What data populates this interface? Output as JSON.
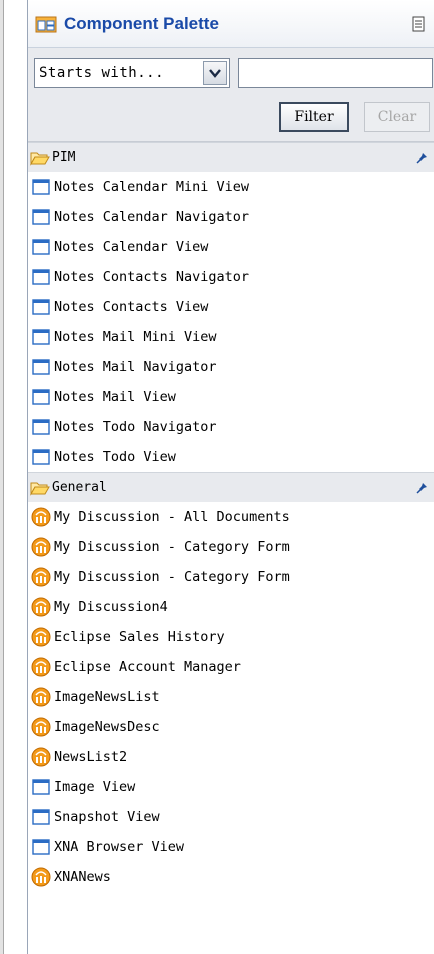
{
  "panel": {
    "title": "Component Palette",
    "title_icon": "palette-icon",
    "menu_icon": "view-menu-icon"
  },
  "filter": {
    "select_value": "Starts with...",
    "input_value": "",
    "filter_label": "Filter",
    "clear_label": "Clear"
  },
  "categories": [
    {
      "label": "PIM",
      "items": [
        {
          "label": "Notes Calendar Mini View",
          "icon": "view-window-icon"
        },
        {
          "label": "Notes Calendar Navigator",
          "icon": "view-window-icon"
        },
        {
          "label": "Notes Calendar View",
          "icon": "view-window-icon"
        },
        {
          "label": "Notes Contacts Navigator",
          "icon": "view-window-icon"
        },
        {
          "label": "Notes Contacts View",
          "icon": "view-window-icon"
        },
        {
          "label": "Notes Mail Mini View",
          "icon": "view-window-icon"
        },
        {
          "label": "Notes Mail Navigator",
          "icon": "view-window-icon"
        },
        {
          "label": "Notes Mail View",
          "icon": "view-window-icon"
        },
        {
          "label": "Notes Todo Navigator",
          "icon": "view-window-icon"
        },
        {
          "label": "Notes Todo View",
          "icon": "view-window-icon"
        }
      ]
    },
    {
      "label": "General",
      "items": [
        {
          "label": "My Discussion - All Documents",
          "icon": "feed-icon"
        },
        {
          "label": "My Discussion - Category Form",
          "icon": "feed-icon"
        },
        {
          "label": "My Discussion - Category Form",
          "icon": "feed-icon"
        },
        {
          "label": "My Discussion4",
          "icon": "feed-icon"
        },
        {
          "label": "Eclipse Sales History",
          "icon": "feed-icon"
        },
        {
          "label": "Eclipse Account Manager",
          "icon": "feed-icon"
        },
        {
          "label": "ImageNewsList",
          "icon": "feed-icon"
        },
        {
          "label": "ImageNewsDesc",
          "icon": "feed-icon"
        },
        {
          "label": "NewsList2",
          "icon": "feed-icon"
        },
        {
          "label": "Image View",
          "icon": "view-window-icon"
        },
        {
          "label": "Snapshot View",
          "icon": "view-window-icon"
        },
        {
          "label": "XNA Browser View",
          "icon": "view-window-icon"
        },
        {
          "label": "XNANews",
          "icon": "feed-icon"
        }
      ]
    }
  ],
  "colors": {
    "title_text": "#1a4aa8",
    "category_bg": "#e8eaee",
    "feed_orange": "#f39a1a",
    "view_blue": "#2b6cc4"
  }
}
